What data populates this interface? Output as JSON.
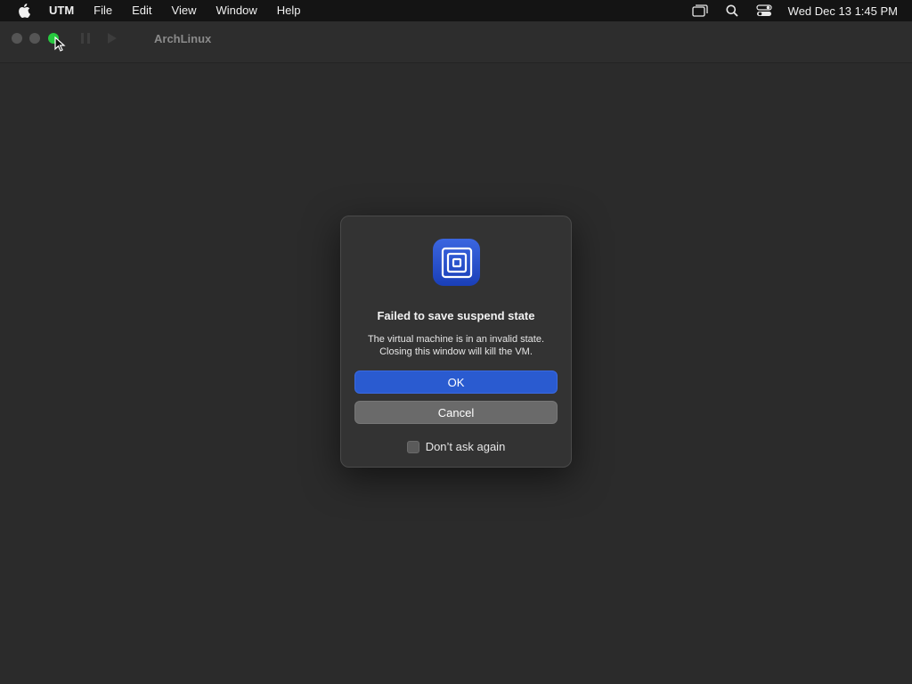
{
  "menubar": {
    "app_name": "UTM",
    "items": [
      "File",
      "Edit",
      "View",
      "Window",
      "Help"
    ],
    "clock": "Wed Dec 13  1:45 PM"
  },
  "window": {
    "title": "ArchLinux"
  },
  "dialog": {
    "title": "Failed to save suspend state",
    "message_line1": "The virtual machine is in an invalid state.",
    "message_line2": "Closing this window will kill the VM.",
    "ok_label": "OK",
    "cancel_label": "Cancel",
    "checkbox_label": "Don’t ask again",
    "checkbox_checked": false
  },
  "colors": {
    "accent": "#2a5bd0",
    "background": "#2b2b2b",
    "zoom_button": "#27c93f"
  },
  "icons": [
    "apple-icon",
    "window-list-icon",
    "search-icon",
    "control-center-icon",
    "utm-app-icon",
    "pause-icon",
    "play-icon",
    "mouse-cursor-icon"
  ]
}
